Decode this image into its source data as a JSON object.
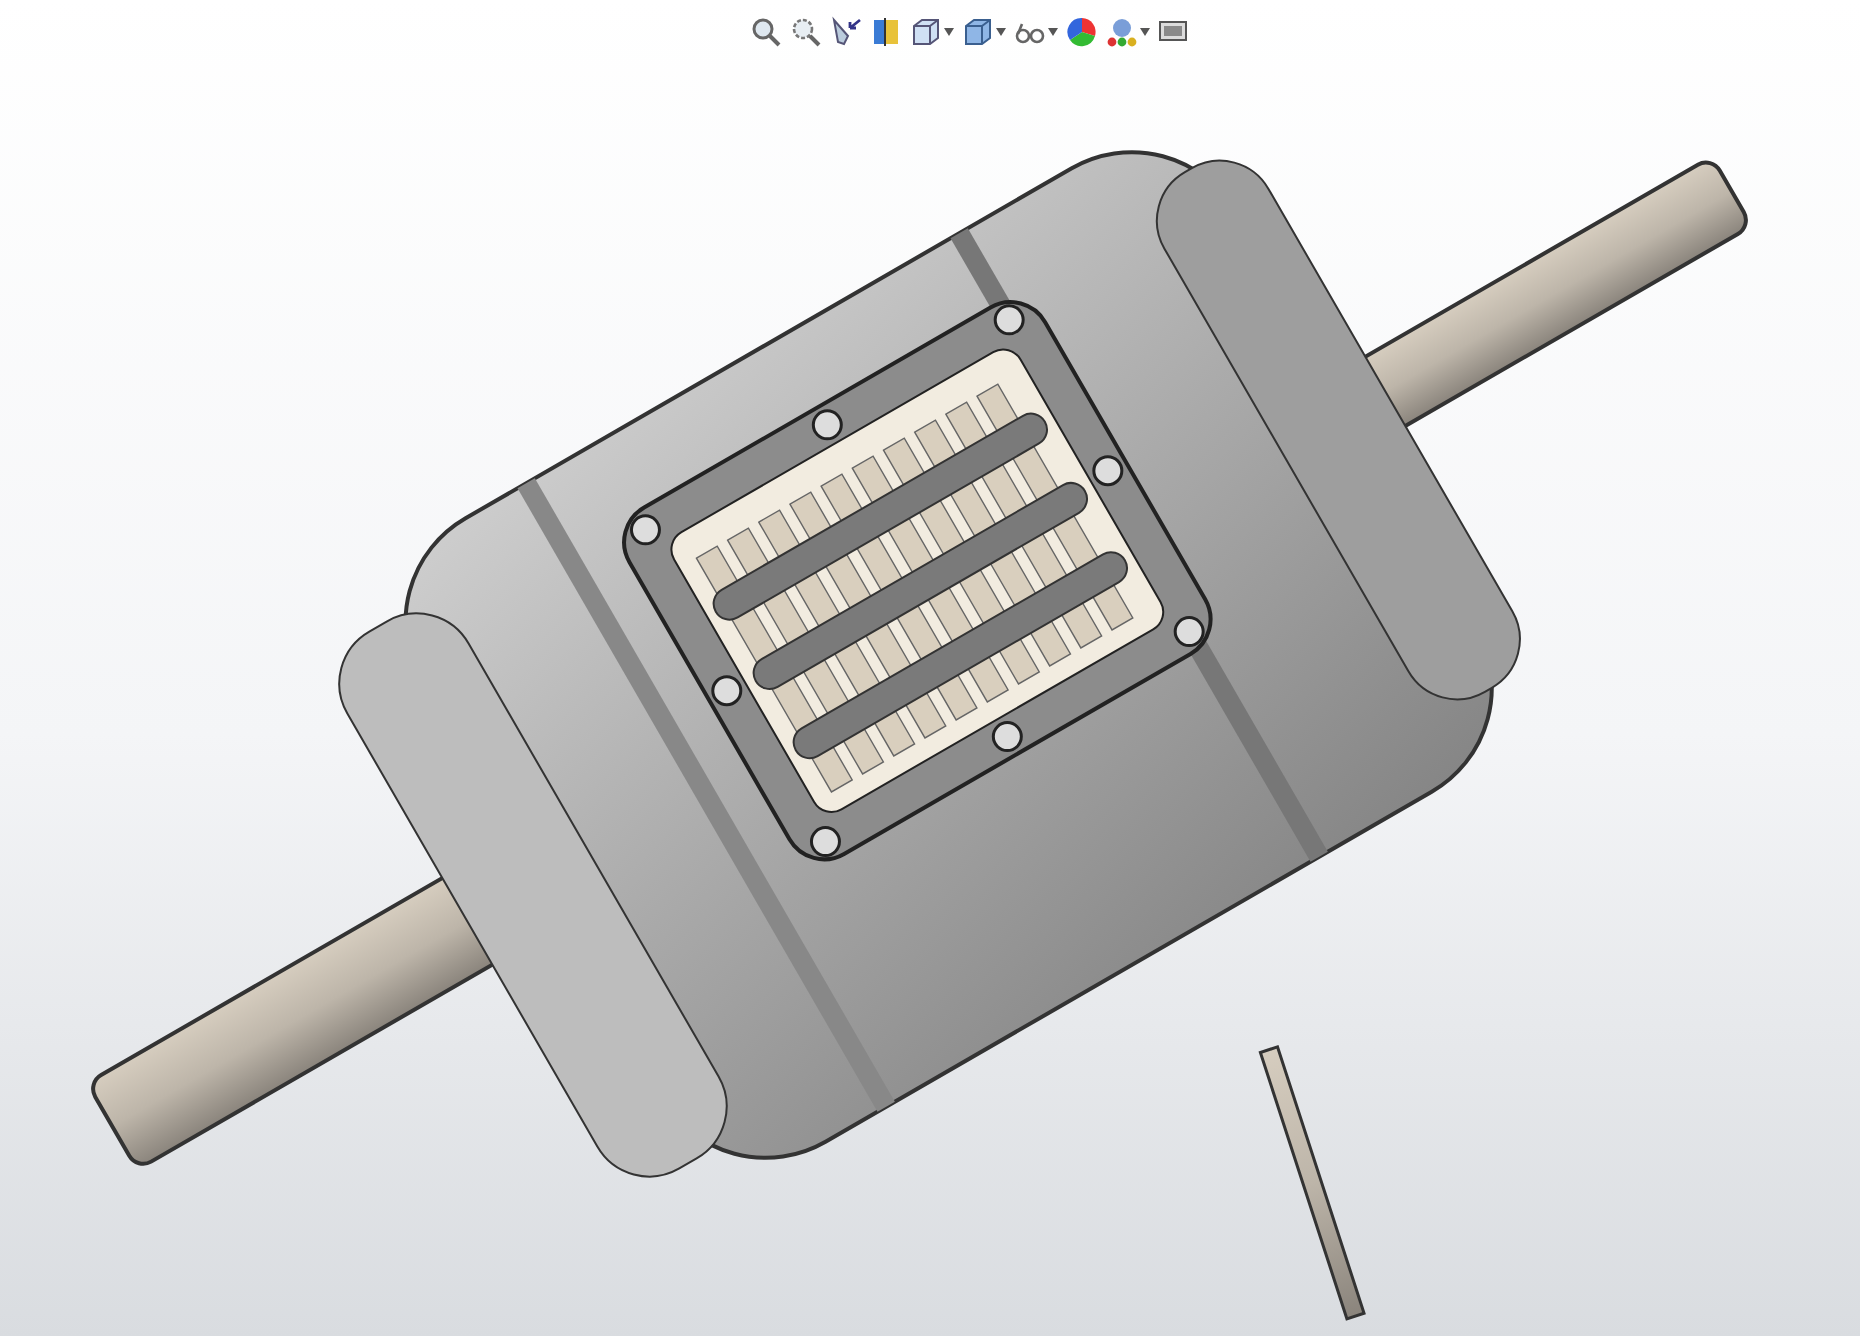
{
  "view_toolbar": {
    "items": [
      {
        "kind": "zoom-fit",
        "dropdown": false
      },
      {
        "kind": "zoom-area",
        "dropdown": false
      },
      {
        "kind": "previous-view",
        "dropdown": false
      },
      {
        "kind": "section",
        "dropdown": false
      },
      {
        "kind": "orientation",
        "dropdown": true
      },
      {
        "kind": "display-style",
        "dropdown": true
      },
      {
        "kind": "hide-show",
        "dropdown": true
      },
      {
        "kind": "appearance",
        "dropdown": false
      },
      {
        "kind": "scene",
        "dropdown": true
      },
      {
        "kind": "view-settings",
        "dropdown": false
      }
    ]
  }
}
